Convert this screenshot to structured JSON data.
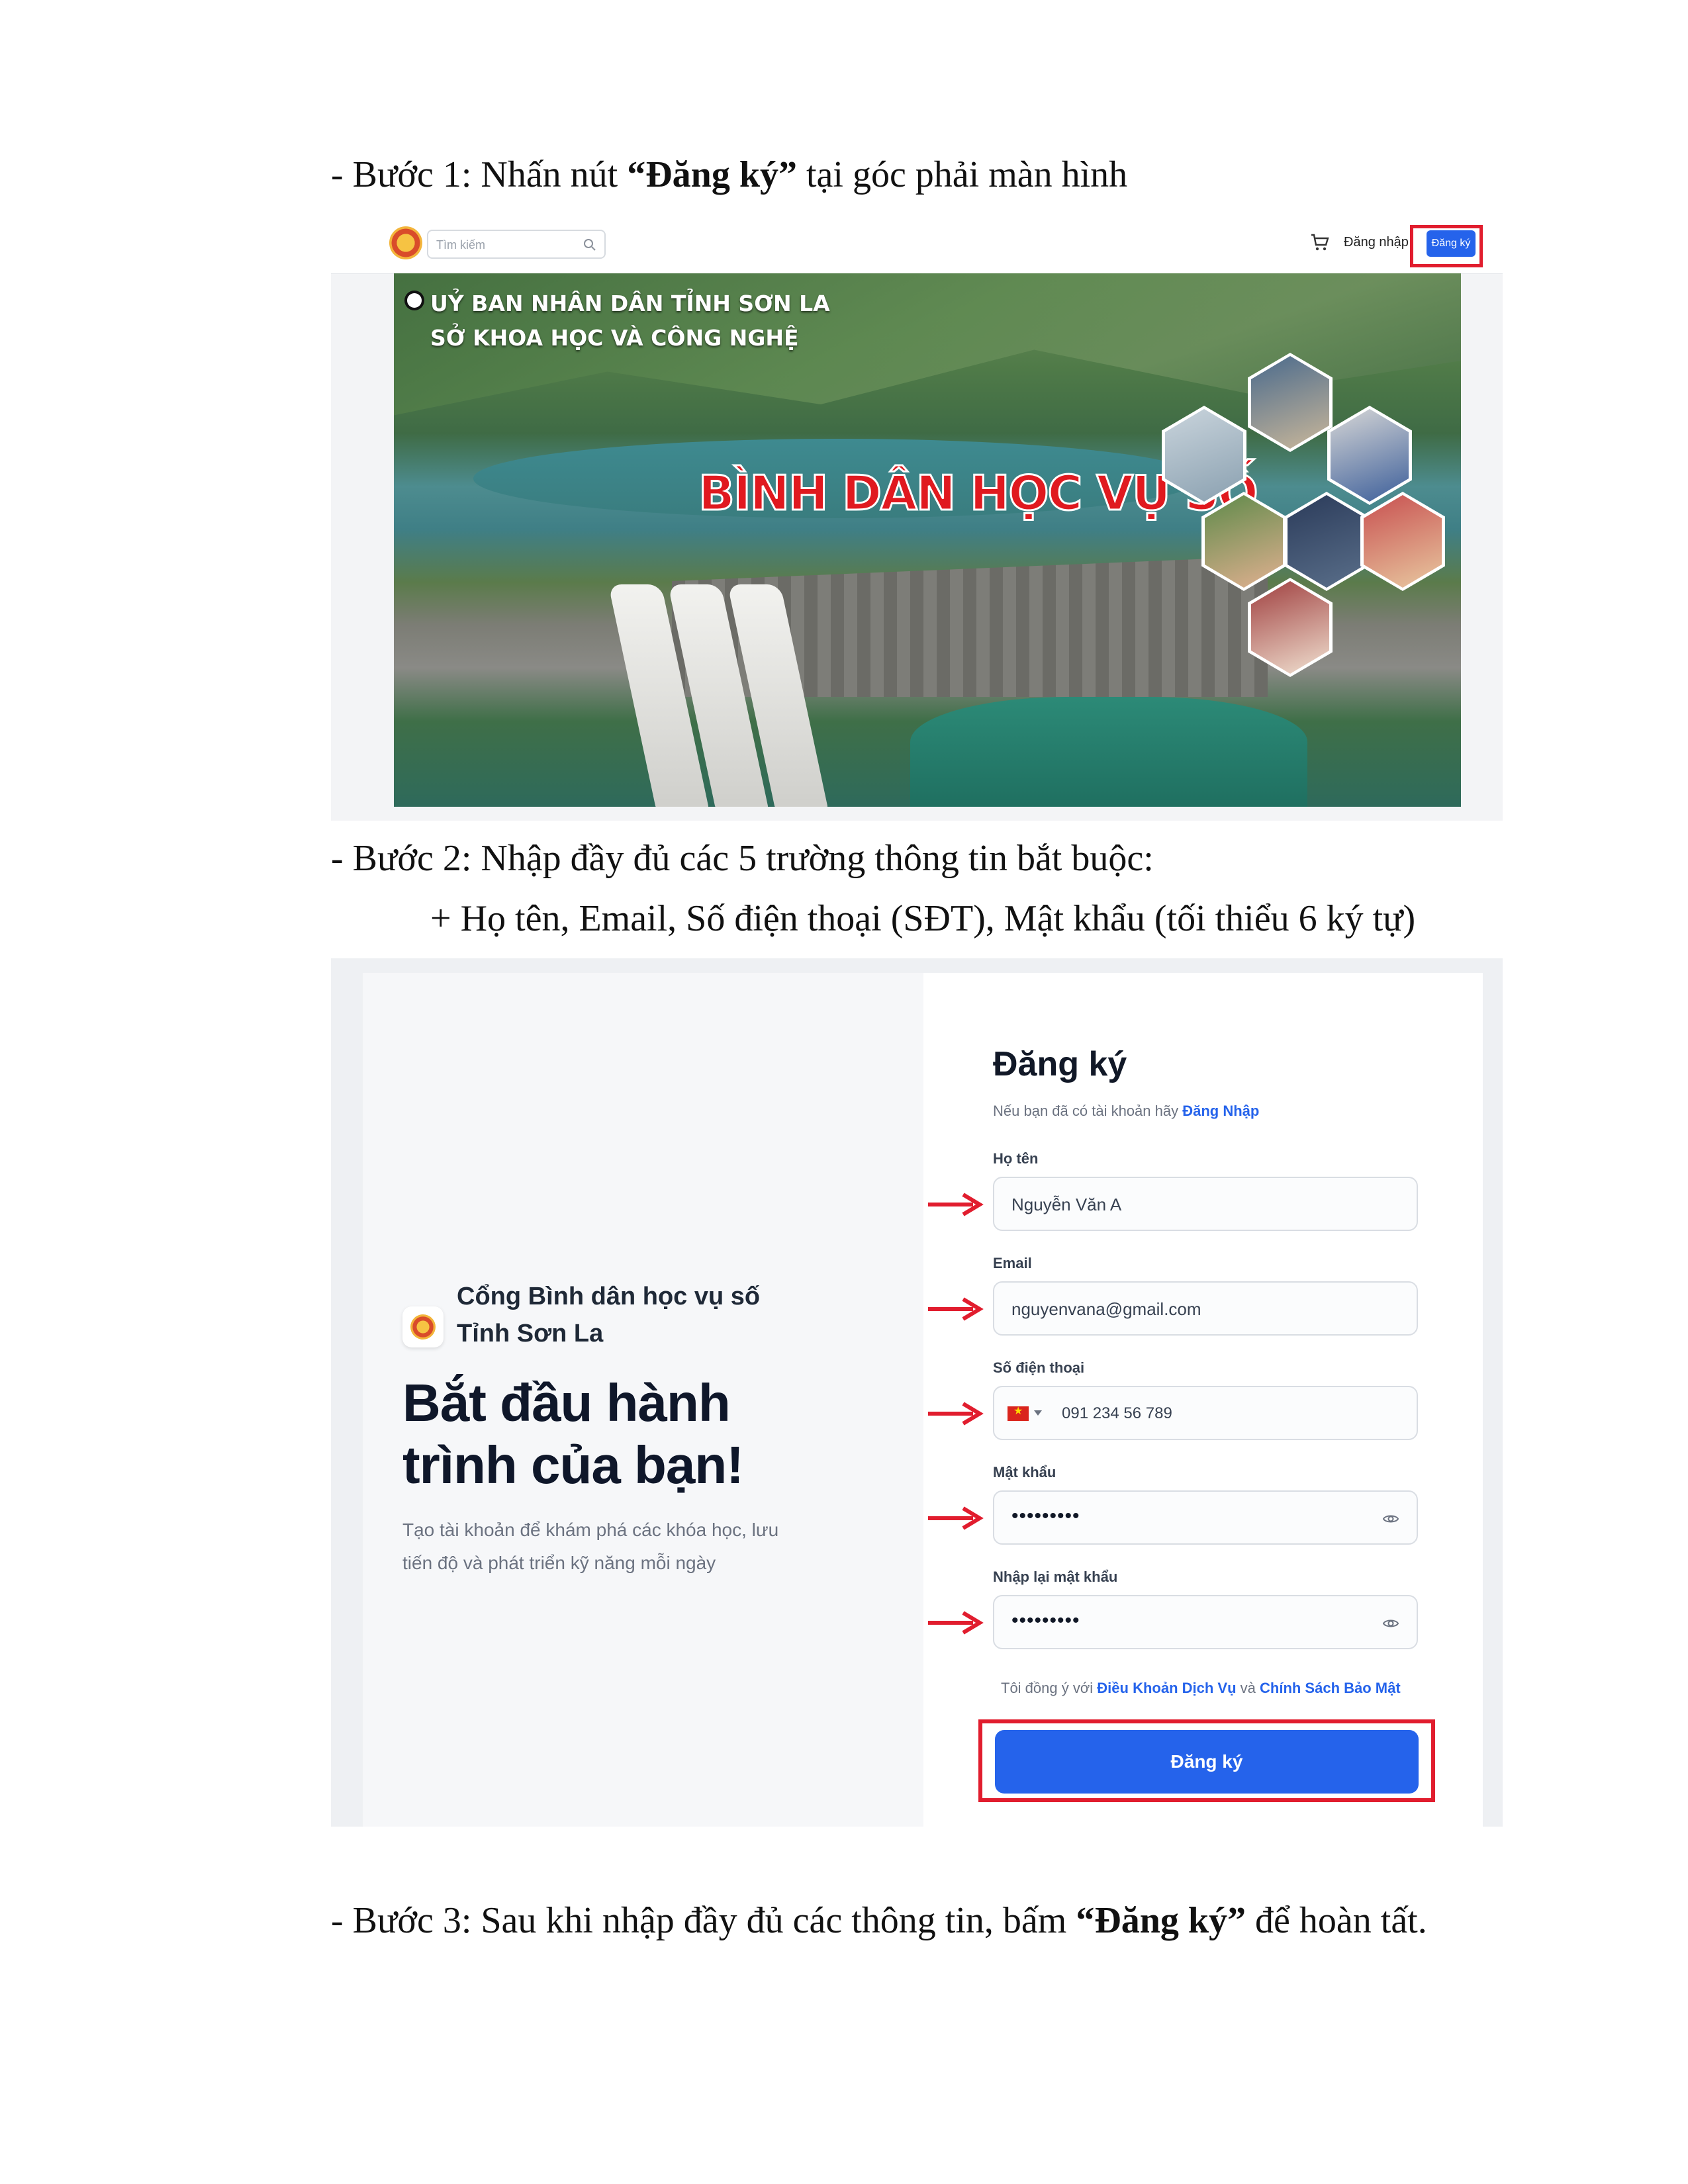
{
  "document": {
    "step1": {
      "prefix": "- Bước 1: Nhấn nút ",
      "bold": "“Đăng ký”",
      "suffix": " tại góc phải màn hình"
    },
    "step2": {
      "line1": "- Bước 2: Nhập đầy đủ các 5 trường thông tin bắt buộc:",
      "line2": "+ Họ tên, Email, Số điện thoại (SĐT), Mật khẩu (tối thiểu 6 ký tự)"
    },
    "step3": {
      "prefix": "- Bước 3: Sau khi nhập đầy đủ các thông tin, bấm ",
      "bold": "“Đăng ký”",
      "suffix": " để hoàn tất."
    }
  },
  "screenshot1": {
    "search_placeholder": "Tìm kiếm",
    "login_label": "Đăng nhập",
    "register_label": "Đăng ký",
    "banner": {
      "line1": "UỶ BAN NHÂN DÂN TỈNH SƠN LA",
      "line2": "SỞ KHOA HỌC VÀ CÔNG NGHỆ",
      "title": "BÌNH DÂN HỌC VỤ SỐ"
    },
    "highlight_color": "#e11d2e"
  },
  "screenshot2": {
    "brand_line1": "Cổng Bình dân học vụ số",
    "brand_line2": "Tỉnh Sơn La",
    "hero_line1": "Bắt đầu hành",
    "hero_line2": "trình của bạn!",
    "sub_line1": "Tạo tài khoản để khám phá các khóa học, lưu",
    "sub_line2": "tiến độ và phát triển kỹ năng mỗi ngày",
    "form": {
      "title": "Đăng ký",
      "hint_prefix": "Nếu bạn đã có tài khoản hãy ",
      "hint_link": "Đăng Nhập",
      "fullname_label": "Họ tên",
      "fullname_value": "Nguyễn Văn A",
      "email_label": "Email",
      "email_value": "nguyenvana@gmail.com",
      "phone_label": "Số điện thoại",
      "phone_value": "091 234 56 789",
      "password_label": "Mật khẩu",
      "password_value": "•••••••••",
      "confirm_label": "Nhập lại mật khẩu",
      "confirm_value": "•••••••••",
      "terms_prefix": "Tôi đồng ý với ",
      "terms_link1": "Điều Khoản Dịch Vụ",
      "terms_mid": " và ",
      "terms_link2": "Chính Sách Bảo Mật",
      "submit_label": "Đăng ký"
    },
    "accent_color": "#2563eb",
    "arrow_color": "#e11d2e"
  }
}
